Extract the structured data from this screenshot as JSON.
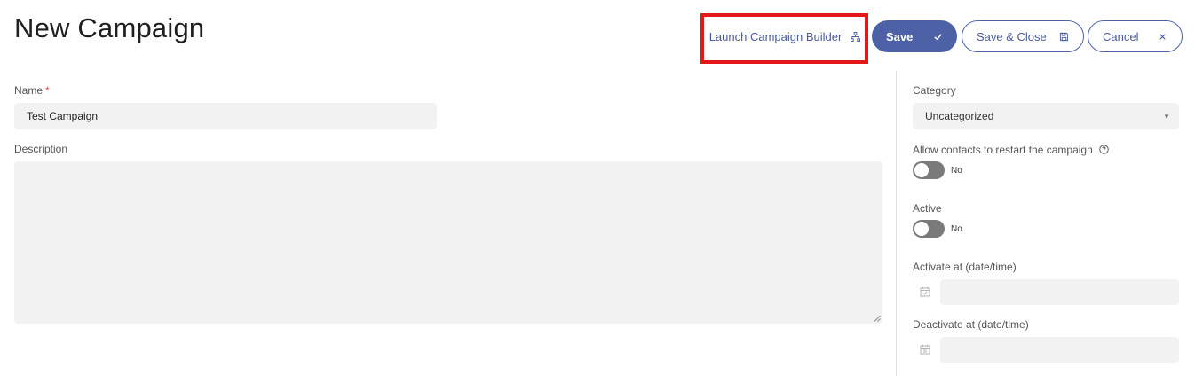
{
  "page": {
    "title": "New Campaign"
  },
  "toolbar": {
    "builder_label": "Launch Campaign Builder",
    "save_label": "Save",
    "save_close_label": "Save & Close",
    "cancel_label": "Cancel"
  },
  "form": {
    "name": {
      "label": "Name",
      "required_mark": "*",
      "value": "Test Campaign"
    },
    "description": {
      "label": "Description",
      "value": ""
    }
  },
  "sidebar": {
    "category": {
      "label": "Category",
      "value": "Uncategorized"
    },
    "allow_restart": {
      "label": "Allow contacts to restart the campaign",
      "state_text": "No"
    },
    "active": {
      "label": "Active",
      "state_text": "No"
    },
    "activate_at": {
      "label": "Activate at (date/time)",
      "value": ""
    },
    "deactivate_at": {
      "label": "Deactivate at (date/time)",
      "value": ""
    }
  },
  "colors": {
    "primary": "#4d62a6",
    "highlight": "#e3181b",
    "toggle_off": "#7a7a7a",
    "field_bg": "#f2f2f2"
  },
  "icons": {
    "builder": "sitemap-icon",
    "save": "check-icon",
    "save_close": "floppy-disk-icon",
    "cancel": "close-icon",
    "help": "question-circle-icon",
    "calendar": "calendar-icon",
    "select": "caret-down-icon"
  }
}
